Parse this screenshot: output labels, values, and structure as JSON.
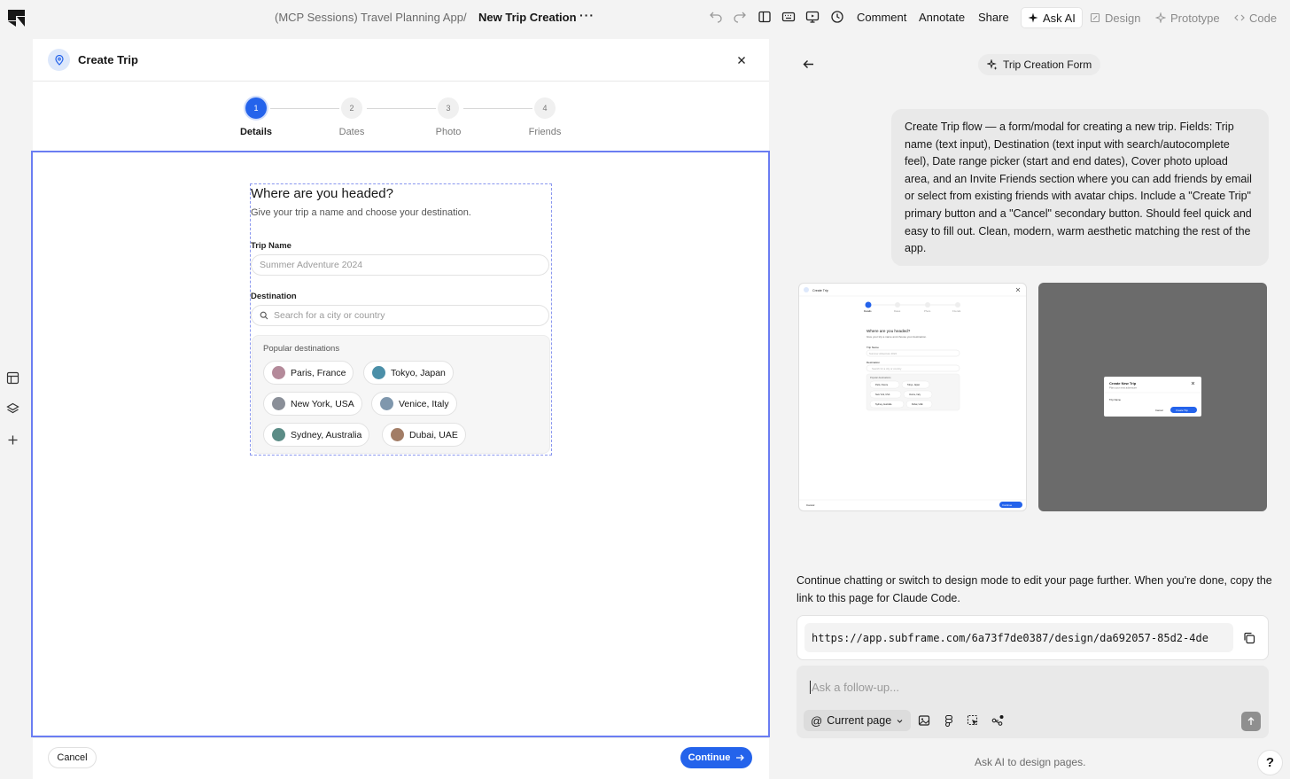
{
  "topbar": {
    "project": "(MCP Sessions) Travel Planning App",
    "separator": "/",
    "page_name": "New Trip Creation",
    "more": "···",
    "links": {
      "comment": "Comment",
      "annotate": "Annotate",
      "share": "Share"
    },
    "tabs": {
      "ask_ai": "Ask AI",
      "design": "Design",
      "prototype": "Prototype",
      "code": "Code"
    },
    "active_tab": "ask_ai"
  },
  "dialog": {
    "title": "Create Trip",
    "steps": [
      {
        "number": "1",
        "label": "Details",
        "active": true
      },
      {
        "number": "2",
        "label": "Dates",
        "active": false
      },
      {
        "number": "3",
        "label": "Photo",
        "active": false
      },
      {
        "number": "4",
        "label": "Friends",
        "active": false
      }
    ],
    "form": {
      "heading": "Where are you headed?",
      "subheading": "Give your trip a name and choose your destination.",
      "trip_name_label": "Trip Name",
      "trip_name_placeholder": "Summer Adventure 2024",
      "destination_label": "Destination",
      "destination_placeholder": "Search for a city or country",
      "popular_title": "Popular destinations",
      "destinations": [
        {
          "label": "Paris, France",
          "color": "#b48a9a"
        },
        {
          "label": "Tokyo, Japan",
          "color": "#4b8fa8"
        },
        {
          "label": "New York, USA",
          "color": "#8a8f98"
        },
        {
          "label": "Venice, Italy",
          "color": "#7f97ad"
        },
        {
          "label": "Sydney, Australia",
          "color": "#5b8c86"
        },
        {
          "label": "Dubai, UAE",
          "color": "#a27d66"
        }
      ]
    },
    "cancel_label": "Cancel",
    "continue_label": "Continue"
  },
  "ai_panel": {
    "pill_label": "Trip Creation Form",
    "prompt": "Create Trip flow — a form/modal for creating a new trip. Fields: Trip name (text input), Destination (text input with search/autocomplete feel), Date range picker (start and end dates), Cover photo upload area, and an Invite Friends section where you can add friends by email or select from existing friends with avatar chips. Include a \"Create Trip\" primary button and a \"Cancel\" secondary button. Should feel quick and easy to fill out. Clean, modern, warm aesthetic matching the rest of the app.",
    "thumb1": {
      "title": "Create Trip",
      "steps": [
        "Details",
        "Dates",
        "Photo",
        "Friends"
      ],
      "heading": "Where are you headed?",
      "subheading": "Give your trip a name and choose your destination.",
      "trip_name_label": "Trip Name",
      "trip_name_placeholder": "Summer Adventure 2024",
      "destination_label": "Destination",
      "destination_placeholder": "Search for a city or country",
      "popular_title": "Popular destinations",
      "chips": [
        "Paris, France",
        "Tokyo, Japan",
        "New York, USA",
        "Venice, Italy",
        "Sydney, Australia",
        "Dubai, UAE"
      ],
      "cancel": "Cancel",
      "continue": "Continue"
    },
    "thumb2": {
      "title": "Create New Trip",
      "subtitle": "Plan your next adventure",
      "field_label": "Trip Name",
      "cancel": "Cancel",
      "create": "Create Trip"
    },
    "follow_message": "Continue chatting or switch to design mode to edit your page further. When you're done, copy the link to this page for Claude Code.",
    "url": "https://app.subframe.com/6a73f7de0387/design/da692057-85d2-4de",
    "composer_placeholder": "Ask a follow-up...",
    "current_page_label": "Current page",
    "footer": "Ask AI to design pages.",
    "help": "?"
  },
  "colors": {
    "accent": "#2463eb",
    "selection": "#6a7df2",
    "app_bg": "#f3f3f3"
  }
}
